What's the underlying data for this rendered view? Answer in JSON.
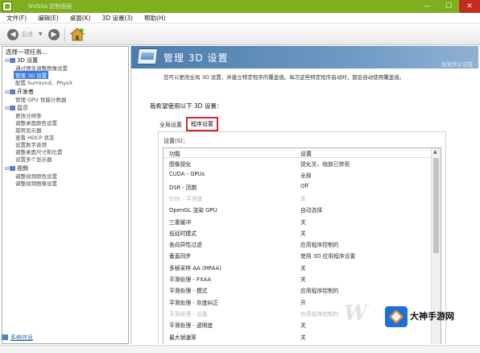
{
  "window": {
    "title": "NVIDIA 控制面板",
    "controls": [
      "—",
      "☐",
      "✕"
    ]
  },
  "menu": [
    "文件(F)",
    "编辑(E)",
    "桌面(K)",
    "3D 设置(3)",
    "帮助(H)"
  ],
  "toolbar": {
    "back_label": "后退"
  },
  "tree": {
    "header": "选择一项任务...",
    "items": [
      {
        "label": "3D 设置",
        "level": 0
      },
      {
        "label": "通过预览调整图像设置",
        "level": 1
      },
      {
        "label": "管理 3D 设置",
        "level": 1,
        "selected": true
      },
      {
        "label": "配置 Surround、PhysX",
        "level": 1
      },
      {
        "label": "开发者",
        "level": 0
      },
      {
        "label": "管理 GPU 性能计数器",
        "level": 1
      },
      {
        "label": "显示",
        "level": 0
      },
      {
        "label": "更改分辨率",
        "level": 1
      },
      {
        "label": "调整桌面颜色设置",
        "level": 1
      },
      {
        "label": "旋转显示器",
        "level": 1
      },
      {
        "label": "查看 HDCP 状态",
        "level": 1
      },
      {
        "label": "设置数字音频",
        "level": 1
      },
      {
        "label": "调整桌面尺寸和位置",
        "level": 1
      },
      {
        "label": "设置多个显示器",
        "level": 1
      },
      {
        "label": "视频",
        "level": 0
      },
      {
        "label": "调整视频颜色设置",
        "level": 1
      },
      {
        "label": "调整视频图像设置",
        "level": 1
      }
    ],
    "system_info": "系统信息"
  },
  "main": {
    "title": "管理 3D 设置",
    "restore": "恢复默认设置",
    "description": "您可以更改全局 3D 设置，并建立特定程序的覆盖值。每次这些特定程序启动时，都会自动使用覆盖值。",
    "prompt": "我希望使用以下 3D 设置：",
    "tabs": {
      "global": "全局设置",
      "program": "程序设置"
    },
    "settings_label": "设置(S)：",
    "columns": {
      "feature": "功能",
      "setting": "设置"
    },
    "rows": [
      {
        "feature": "图像锐化",
        "value": "锐化关，缩放已禁用"
      },
      {
        "feature": "CUDA - GPUs",
        "value": "全部"
      },
      {
        "feature": "DSR - 因数",
        "value": "Off"
      },
      {
        "feature": "DSR - 平滑度",
        "value": "关",
        "disabled": true
      },
      {
        "feature": "OpenGL 渲染 GPU",
        "value": "自动选择"
      },
      {
        "feature": "三重缓冲",
        "value": "关"
      },
      {
        "feature": "低延时模式",
        "value": "关"
      },
      {
        "feature": "各向异性过滤",
        "value": "应用程序控制的"
      },
      {
        "feature": "垂直同步",
        "value": "使用 3D 应用程序设置"
      },
      {
        "feature": "多帧采样 AA (MFAA)",
        "value": "关"
      },
      {
        "feature": "平滑处理 - FXAA",
        "value": "关"
      },
      {
        "feature": "平滑处理 - 模式",
        "value": "应用程序控制的"
      },
      {
        "feature": "平滑处理 - 灰度纠正",
        "value": "开"
      },
      {
        "feature": "平滑处理 - 设置",
        "value": "应用程序控制的",
        "disabled": true
      },
      {
        "feature": "平滑处理 - 透明度",
        "value": "关"
      },
      {
        "feature": "最大帧速率",
        "value": "关"
      }
    ]
  },
  "watermark": {
    "text": "W",
    "brand": "大神手游网"
  }
}
